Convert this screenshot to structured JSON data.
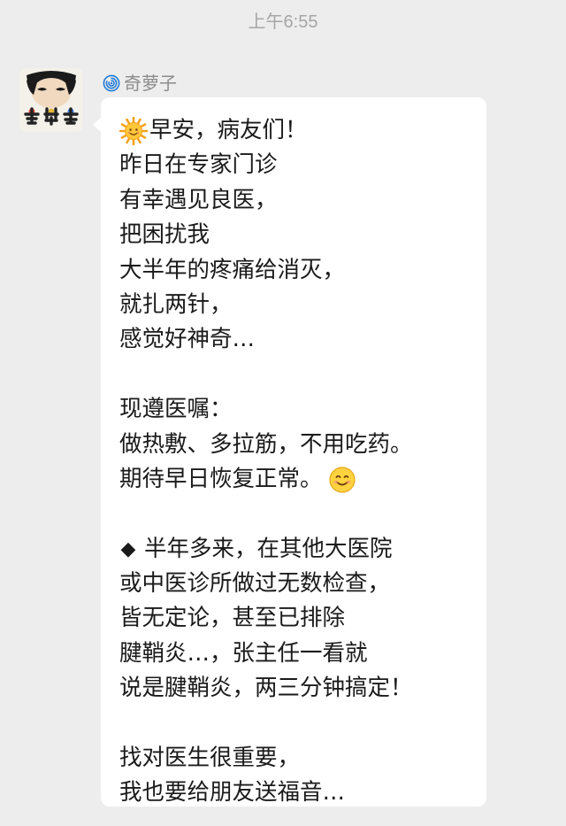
{
  "status": {
    "time": "上午6:55"
  },
  "sender": {
    "name": "奇萝子",
    "icon": "spiral-icon",
    "avatar_text": "奇萝子"
  },
  "message": {
    "lines": [
      {
        "text": "早安，病友们！",
        "emoji_before": "sun-emoji"
      },
      {
        "text": "昨日在专家门诊"
      },
      {
        "text": "有幸遇见良医，"
      },
      {
        "text": "把困扰我"
      },
      {
        "text": "大半年的疼痛给消灭，"
      },
      {
        "text": "就扎两针，"
      },
      {
        "text": "感觉好神奇…"
      },
      {
        "text": ""
      },
      {
        "text": "现遵医嘱："
      },
      {
        "text": "做热敷、多拉筋，不用吃药。"
      },
      {
        "text": "期待早日恢复正常。",
        "emoji_after": "smile-emoji"
      },
      {
        "text": ""
      },
      {
        "text": "半年多来，在其他大医院",
        "bullet": "◆"
      },
      {
        "text": "或中医诊所做过无数检查，"
      },
      {
        "text": "皆无定论，甚至已排除"
      },
      {
        "text": "腱鞘炎…，张主任一看就"
      },
      {
        "text": "说是腱鞘炎，两三分钟搞定！"
      },
      {
        "text": ""
      },
      {
        "text": "找对医生很重要，"
      },
      {
        "text": "我也要给朋友送福音…"
      }
    ]
  },
  "colors": {
    "background": "#ededed",
    "bubble": "#ffffff",
    "timestamp": "#a6a6a6",
    "sender_name": "#8c8c8c",
    "text": "#1a1a1a"
  }
}
